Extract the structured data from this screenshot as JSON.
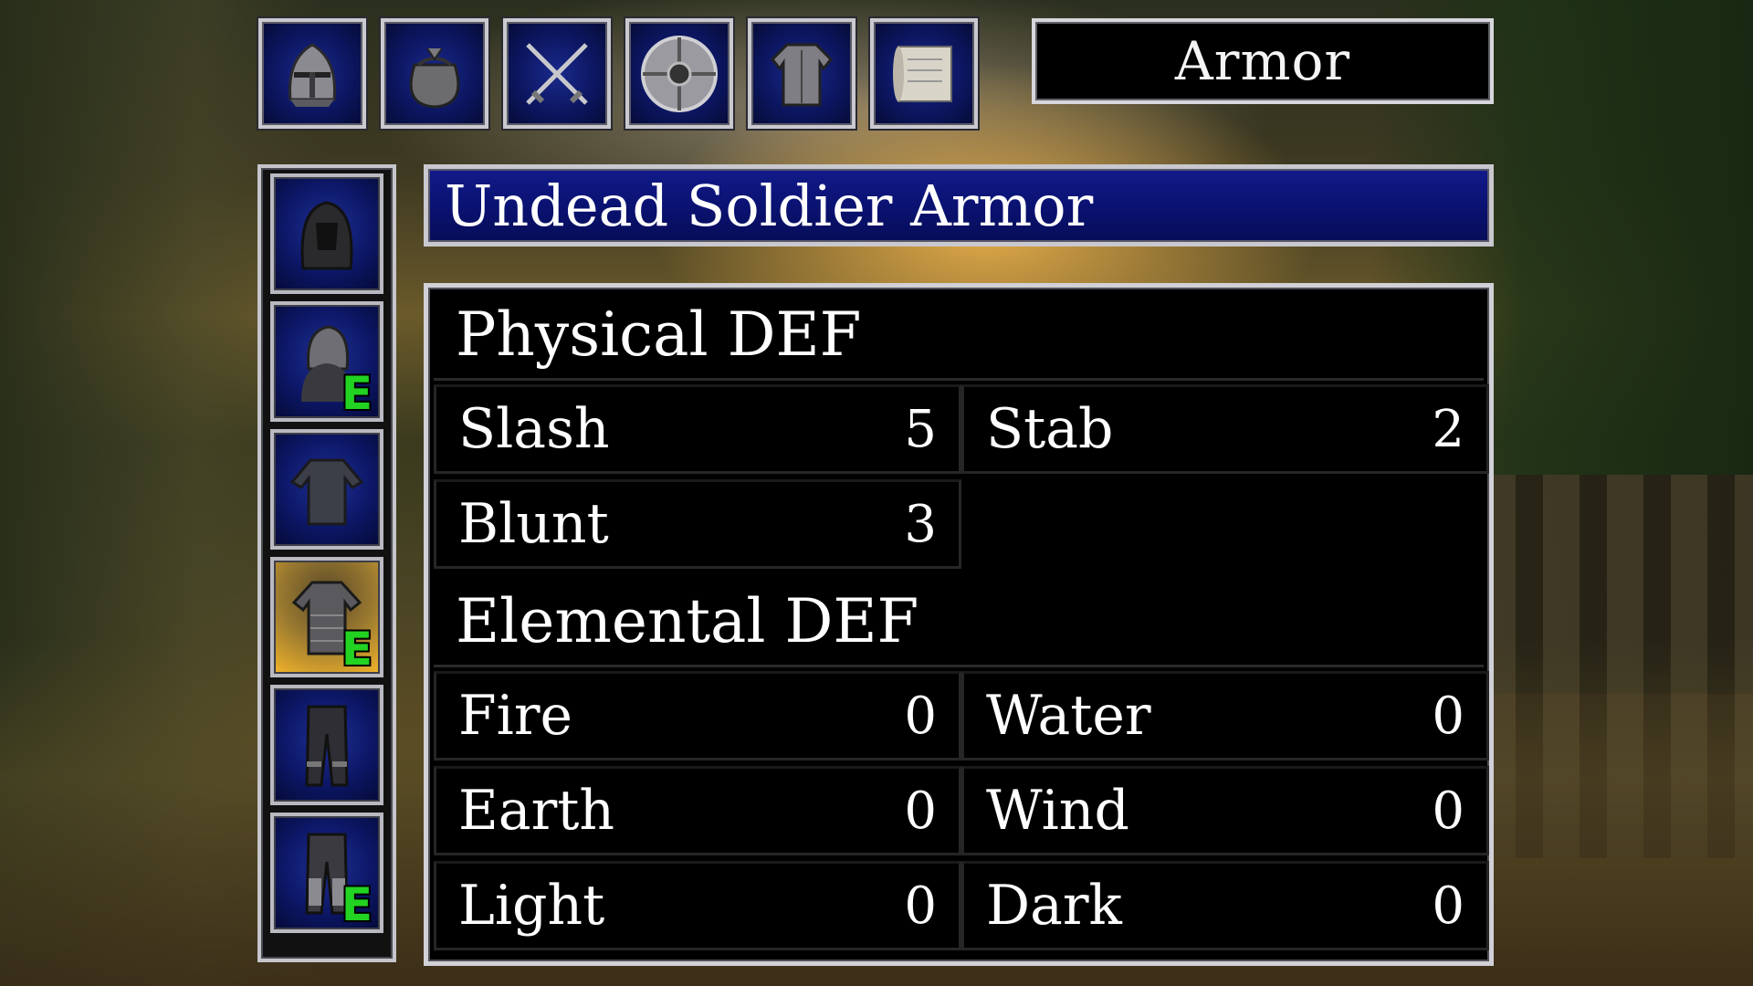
{
  "tabs": [
    {
      "name": "helmet-tab",
      "icon": "helmet-icon"
    },
    {
      "name": "pouch-tab",
      "icon": "pouch-icon"
    },
    {
      "name": "weapons-tab",
      "icon": "crossed-swords-icon"
    },
    {
      "name": "shield-tab",
      "icon": "shield-icon"
    },
    {
      "name": "armor-tab",
      "icon": "armor-icon"
    },
    {
      "name": "scroll-tab",
      "icon": "scroll-icon"
    }
  ],
  "category": "Armor",
  "item_title": "Undead Soldier Armor",
  "items": [
    {
      "icon": "hood-icon",
      "equipped": false,
      "badge": ""
    },
    {
      "icon": "helmet-coif-icon",
      "equipped": true,
      "badge": "E"
    },
    {
      "icon": "tunic-icon",
      "equipped": false,
      "badge": ""
    },
    {
      "icon": "body-armor-icon",
      "equipped": true,
      "badge": "E",
      "selected": true
    },
    {
      "icon": "pants-icon",
      "equipped": false,
      "badge": ""
    },
    {
      "icon": "greaves-icon",
      "equipped": true,
      "badge": "E"
    }
  ],
  "stats": {
    "physical_heading": "Physical DEF",
    "slash": {
      "label": "Slash",
      "value": "5"
    },
    "stab": {
      "label": "Stab",
      "value": "2"
    },
    "blunt": {
      "label": "Blunt",
      "value": "3"
    },
    "elemental_heading": "Elemental DEF",
    "fire": {
      "label": "Fire",
      "value": "0"
    },
    "water": {
      "label": "Water",
      "value": "0"
    },
    "earth": {
      "label": "Earth",
      "value": "0"
    },
    "wind": {
      "label": "Wind",
      "value": "0"
    },
    "light": {
      "label": "Light",
      "value": "0"
    },
    "dark": {
      "label": "Dark",
      "value": "0"
    }
  },
  "colors": {
    "equip_badge": "#22d322",
    "slot_blue": "#0c1766",
    "selected_gold": "#f3b42a",
    "title_blue": "#0a1272"
  }
}
